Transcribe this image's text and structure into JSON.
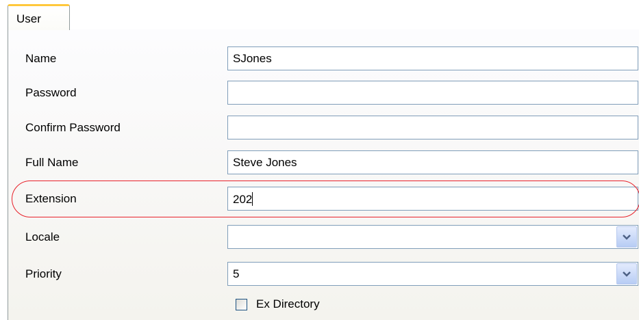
{
  "tabs": [
    {
      "label": "User",
      "selected": true
    }
  ],
  "form": {
    "name": {
      "label": "Name",
      "value": "SJones"
    },
    "password": {
      "label": "Password",
      "value": ""
    },
    "confirm_password": {
      "label": "Confirm Password",
      "value": ""
    },
    "full_name": {
      "label": "Full Name",
      "value": "Steve Jones"
    },
    "extension": {
      "label": "Extension",
      "value": "202",
      "highlighted": true
    },
    "locale": {
      "label": "Locale",
      "value": ""
    },
    "priority": {
      "label": "Priority",
      "value": "5"
    },
    "ex_directory": {
      "label": "Ex Directory",
      "checked": false
    }
  },
  "colors": {
    "tab_accent": "#ffc83c",
    "field_border": "#7f9db9",
    "highlight_ring": "#e8202a",
    "dropdown_button": "#b7ccf4"
  },
  "icons": {
    "dropdown": "chevron-down-icon"
  }
}
